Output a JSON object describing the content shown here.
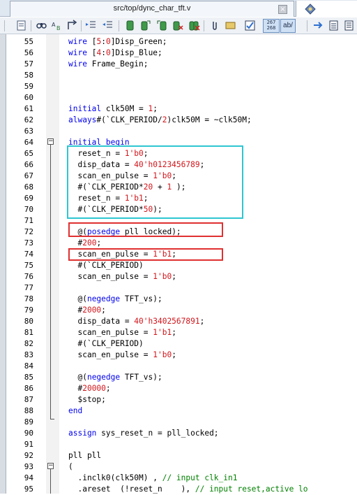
{
  "tab": {
    "title": "src/top/dync_char_tft.v",
    "close": "×"
  },
  "toolbar": {
    "counter_top": "267",
    "counter_bottom": "268",
    "abbr_label": "ab/"
  },
  "lines": [
    {
      "n": "55",
      "parts": [
        [
          "kw",
          "wire "
        ],
        [
          "pl",
          "["
        ],
        [
          "num",
          "5"
        ],
        [
          "pl",
          ":"
        ],
        [
          "num",
          "0"
        ],
        [
          "pl",
          "]Disp_Green;"
        ]
      ]
    },
    {
      "n": "56",
      "parts": [
        [
          "kw",
          "wire "
        ],
        [
          "pl",
          "["
        ],
        [
          "num",
          "4"
        ],
        [
          "pl",
          ":"
        ],
        [
          "num",
          "0"
        ],
        [
          "pl",
          "]Disp_Blue;"
        ]
      ]
    },
    {
      "n": "57",
      "parts": [
        [
          "kw",
          "wire "
        ],
        [
          "pl",
          "Frame_Begin;"
        ]
      ]
    },
    {
      "n": "58",
      "parts": []
    },
    {
      "n": "59",
      "parts": []
    },
    {
      "n": "60",
      "parts": []
    },
    {
      "n": "61",
      "parts": [
        [
          "kw",
          "initial "
        ],
        [
          "pl",
          "clk50M = "
        ],
        [
          "num",
          "1"
        ],
        [
          "pl",
          ";"
        ]
      ]
    },
    {
      "n": "62",
      "parts": [
        [
          "kw",
          "always"
        ],
        [
          "pl",
          "#(`CLK_PERIOD/"
        ],
        [
          "num",
          "2"
        ],
        [
          "pl",
          ")clk50M = ~clk50M;"
        ]
      ]
    },
    {
      "n": "63",
      "parts": []
    },
    {
      "n": "64",
      "parts": [
        [
          "kw",
          "initial begin"
        ]
      ]
    },
    {
      "n": "65",
      "parts": [
        [
          "pl",
          "  reset_n = "
        ],
        [
          "num",
          "1'b0"
        ],
        [
          "pl",
          ";"
        ]
      ]
    },
    {
      "n": "66",
      "parts": [
        [
          "pl",
          "  disp_data = "
        ],
        [
          "num",
          "40'h0123456789"
        ],
        [
          "pl",
          ";"
        ]
      ]
    },
    {
      "n": "67",
      "parts": [
        [
          "pl",
          "  scan_en_pulse = "
        ],
        [
          "num",
          "1'b0"
        ],
        [
          "pl",
          ";"
        ]
      ]
    },
    {
      "n": "68",
      "parts": [
        [
          "pl",
          "  #(`CLK_PERIOD*"
        ],
        [
          "num",
          "20"
        ],
        [
          "pl",
          " + "
        ],
        [
          "num",
          "1"
        ],
        [
          "pl",
          " );"
        ]
      ]
    },
    {
      "n": "69",
      "parts": [
        [
          "pl",
          "  reset_n = "
        ],
        [
          "num",
          "1'b1"
        ],
        [
          "pl",
          ";"
        ]
      ]
    },
    {
      "n": "70",
      "parts": [
        [
          "pl",
          "  #(`CLK_PERIOD*"
        ],
        [
          "num",
          "50"
        ],
        [
          "pl",
          ");"
        ]
      ]
    },
    {
      "n": "71",
      "parts": []
    },
    {
      "n": "72",
      "parts": [
        [
          "pl",
          "  @("
        ],
        [
          "kw",
          "posedge "
        ],
        [
          "pl",
          "pll_locked);"
        ]
      ]
    },
    {
      "n": "73",
      "parts": [
        [
          "pl",
          "  #"
        ],
        [
          "num",
          "200"
        ],
        [
          "pl",
          ";"
        ]
      ]
    },
    {
      "n": "74",
      "parts": [
        [
          "pl",
          "  scan_en_pulse = "
        ],
        [
          "num",
          "1'b1"
        ],
        [
          "pl",
          ";"
        ]
      ]
    },
    {
      "n": "75",
      "parts": [
        [
          "pl",
          "  #(`CLK_PERIOD)"
        ]
      ]
    },
    {
      "n": "76",
      "parts": [
        [
          "pl",
          "  scan_en_pulse = "
        ],
        [
          "num",
          "1'b0"
        ],
        [
          "pl",
          ";"
        ]
      ]
    },
    {
      "n": "77",
      "parts": []
    },
    {
      "n": "78",
      "parts": [
        [
          "pl",
          "  @("
        ],
        [
          "kw",
          "negedge "
        ],
        [
          "pl",
          "TFT_vs);"
        ]
      ]
    },
    {
      "n": "79",
      "parts": [
        [
          "pl",
          "  #"
        ],
        [
          "num",
          "2000"
        ],
        [
          "pl",
          ";"
        ]
      ]
    },
    {
      "n": "80",
      "parts": [
        [
          "pl",
          "  disp_data = "
        ],
        [
          "num",
          "40'h3402567891"
        ],
        [
          "pl",
          ";"
        ]
      ]
    },
    {
      "n": "81",
      "parts": [
        [
          "pl",
          "  scan_en_pulse = "
        ],
        [
          "num",
          "1'b1"
        ],
        [
          "pl",
          ";"
        ]
      ]
    },
    {
      "n": "82",
      "parts": [
        [
          "pl",
          "  #(`CLK_PERIOD)"
        ]
      ]
    },
    {
      "n": "83",
      "parts": [
        [
          "pl",
          "  scan_en_pulse = "
        ],
        [
          "num",
          "1'b0"
        ],
        [
          "pl",
          ";"
        ]
      ]
    },
    {
      "n": "84",
      "parts": []
    },
    {
      "n": "85",
      "parts": [
        [
          "pl",
          "  @("
        ],
        [
          "kw",
          "negedge "
        ],
        [
          "pl",
          "TFT_vs);"
        ]
      ]
    },
    {
      "n": "86",
      "parts": [
        [
          "pl",
          "  #"
        ],
        [
          "num",
          "20000"
        ],
        [
          "pl",
          ";"
        ]
      ]
    },
    {
      "n": "87",
      "parts": [
        [
          "pl",
          "  $stop;"
        ]
      ]
    },
    {
      "n": "88",
      "parts": [
        [
          "kw",
          "end"
        ]
      ]
    },
    {
      "n": "89",
      "parts": []
    },
    {
      "n": "90",
      "parts": [
        [
          "kw",
          "assign "
        ],
        [
          "pl",
          "sys_reset_n = pll_locked;"
        ]
      ]
    },
    {
      "n": "91",
      "parts": []
    },
    {
      "n": "92",
      "parts": [
        [
          "pl",
          "pll pll"
        ]
      ]
    },
    {
      "n": "93",
      "parts": [
        [
          "pl",
          "("
        ]
      ]
    },
    {
      "n": "94",
      "parts": [
        [
          "pl",
          "  .inclk0(clk50M) , "
        ],
        [
          "cmt",
          "// input clk_in1"
        ]
      ]
    },
    {
      "n": "95",
      "parts": [
        [
          "pl",
          "  .areset  (!reset_n    ), "
        ],
        [
          "cmt",
          "// input reset,active lo"
        ]
      ]
    }
  ]
}
